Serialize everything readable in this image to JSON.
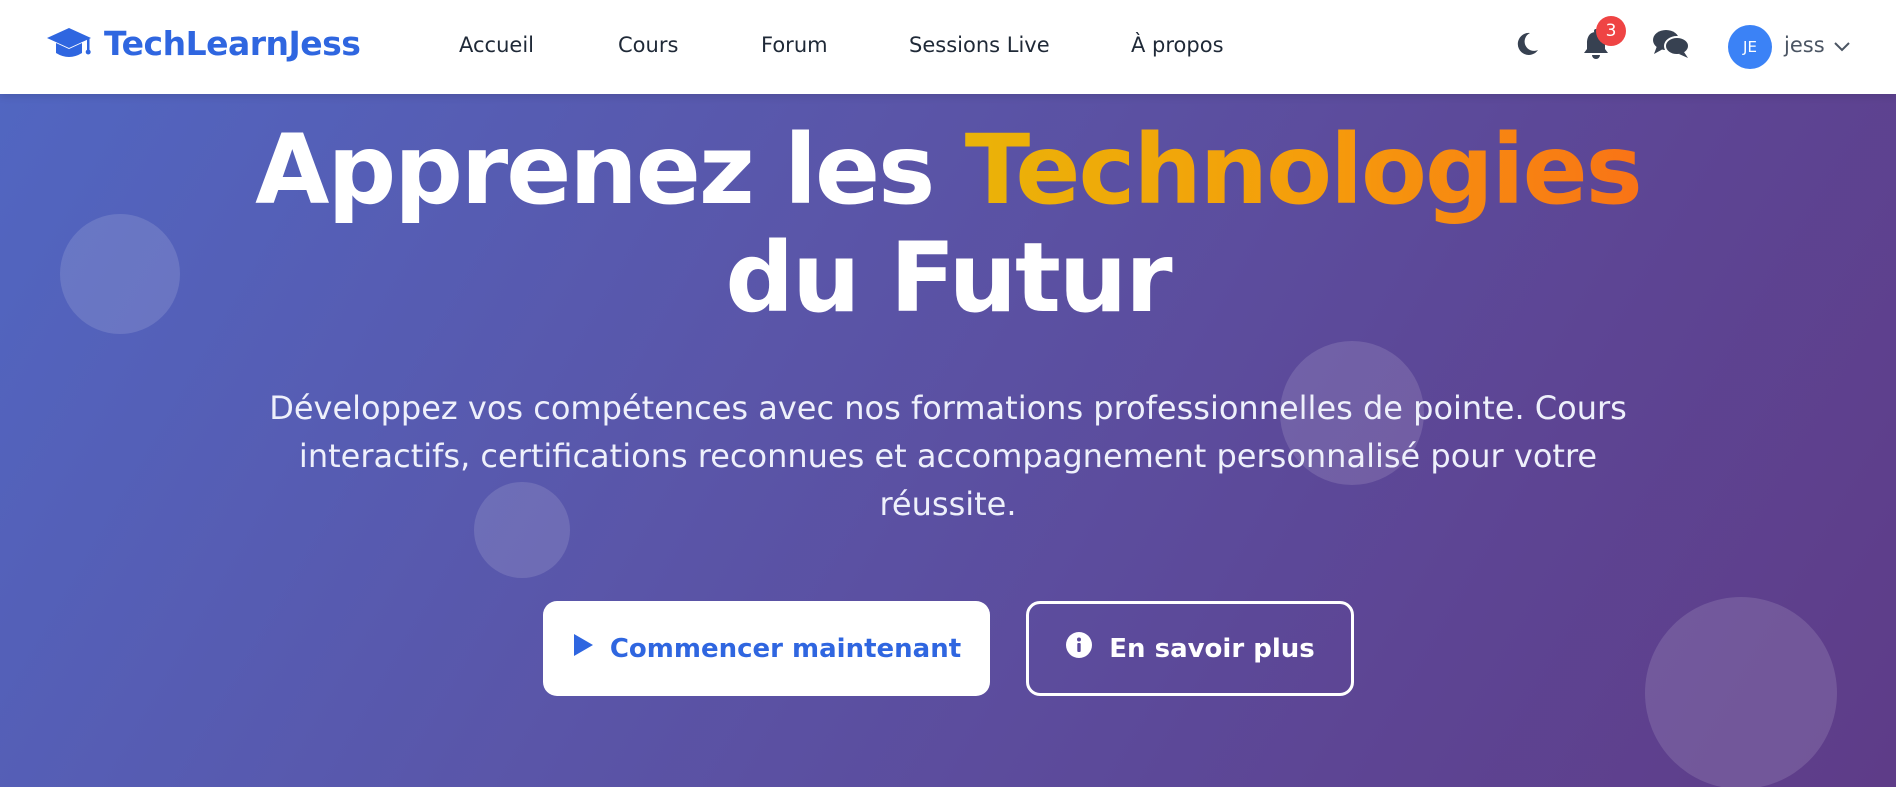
{
  "brand": {
    "name": "TechLearnJess",
    "icon": "graduation-cap-icon",
    "color": "#2f66e0"
  },
  "nav": {
    "links": [
      {
        "label": "Accueil"
      },
      {
        "label": "Cours"
      },
      {
        "label": "Forum"
      },
      {
        "label": "Sessions Live"
      },
      {
        "label": "À propos"
      }
    ]
  },
  "header_actions": {
    "theme_icon": "moon-icon",
    "notifications": {
      "icon": "bell-icon",
      "count": "3"
    },
    "messages_icon": "chat-bubbles-icon",
    "user": {
      "initials": "JE",
      "name": "jess",
      "menu_icon": "chevron-down-icon"
    }
  },
  "hero": {
    "title_part1": "Apprenez les",
    "title_accent": "Technologies",
    "title_part2": "du Futur",
    "subtitle": "Développez vos compétences avec nos formations professionnelles de pointe. Cours interactifs, certifications reconnues et accompagnement personnalisé pour votre réussite.",
    "primary_button": {
      "label": "Commencer maintenant",
      "icon": "play-icon"
    },
    "secondary_button": {
      "label": "En savoir plus",
      "icon": "info-circle-icon"
    }
  },
  "colors": {
    "accent": "#2f66e0",
    "badge": "#ef4444",
    "avatar": "#3b82f6",
    "hero_gradient_start": "#5166c1",
    "hero_gradient_end": "#5e3c88",
    "title_highlight_start": "#eab308",
    "title_highlight_end": "#f97316"
  }
}
